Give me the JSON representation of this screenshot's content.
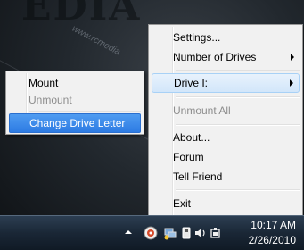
{
  "desktop": {
    "watermark_big": "EDIA",
    "watermark_small": "www.rcmedia"
  },
  "main_menu": {
    "items": [
      {
        "label": "Settings...",
        "state": "normal"
      },
      {
        "label": "Number of Drives",
        "state": "normal",
        "submenu": true
      },
      {
        "label": "Drive I:",
        "state": "active",
        "submenu": true
      },
      {
        "label": "Unmount All",
        "state": "disabled"
      },
      {
        "label": "About...",
        "state": "normal"
      },
      {
        "label": "Forum",
        "state": "normal"
      },
      {
        "label": "Tell Friend",
        "state": "normal"
      },
      {
        "label": "Exit",
        "state": "normal"
      }
    ]
  },
  "submenu": {
    "items": [
      {
        "label": "Mount",
        "state": "normal"
      },
      {
        "label": "Unmount",
        "state": "disabled"
      },
      {
        "label": "Change Drive Letter",
        "state": "highlight"
      }
    ]
  },
  "taskbar": {
    "tray_icons": [
      "chevron-up-icon",
      "daemon-tools-icon",
      "network-icon",
      "removable-drive-icon",
      "volume-icon",
      "power-icon"
    ],
    "clock": {
      "time": "10:17 AM",
      "date": "2/26/2010"
    }
  },
  "colors": {
    "highlight": "#3d8ee8",
    "active_item": "#d9eafb",
    "menu_bg": "#f1f1f1",
    "disabled_text": "#8d8d8d"
  }
}
